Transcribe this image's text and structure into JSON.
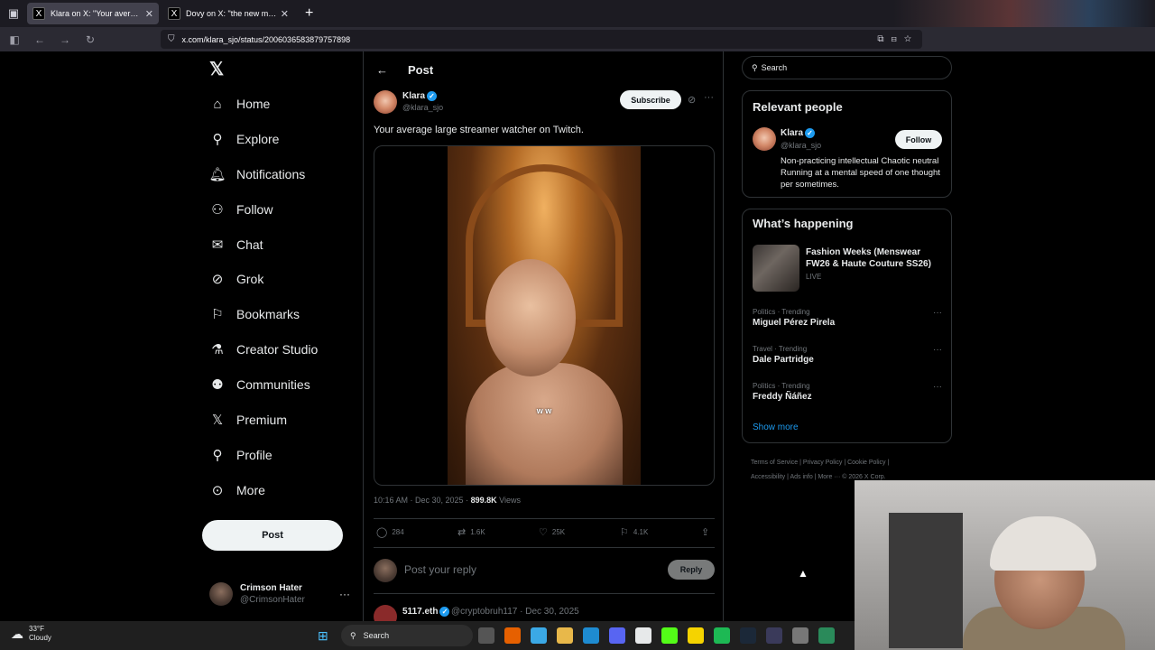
{
  "browser": {
    "tabs": [
      {
        "title": "Klara on X: \"Your average la",
        "active": true
      },
      {
        "title": "Dovy on X: \"the new meta a",
        "active": false
      }
    ],
    "url": "x.com/klara_sjo/status/2006036583879757898"
  },
  "nav": {
    "items": [
      {
        "label": "Home",
        "icon": "home-icon"
      },
      {
        "label": "Explore",
        "icon": "search-icon"
      },
      {
        "label": "Notifications",
        "icon": "bell-icon"
      },
      {
        "label": "Follow",
        "icon": "add-person-icon"
      },
      {
        "label": "Chat",
        "icon": "mail-icon"
      },
      {
        "label": "Grok",
        "icon": "grok-icon"
      },
      {
        "label": "Bookmarks",
        "icon": "bookmark-icon"
      },
      {
        "label": "Creator Studio",
        "icon": "flask-icon"
      },
      {
        "label": "Communities",
        "icon": "people-icon"
      },
      {
        "label": "Premium",
        "icon": "x-logo-icon"
      },
      {
        "label": "Profile",
        "icon": "person-icon"
      },
      {
        "label": "More",
        "icon": "more-circle-icon"
      }
    ],
    "post_button": "Post",
    "account": {
      "name": "Crimson Hater",
      "handle": "@CrimsonHater"
    }
  },
  "post": {
    "header": "Post",
    "author_name": "Klara",
    "author_handle": "@klara_sjo",
    "subscribe": "Subscribe",
    "text": "Your average large streamer watcher on Twitch.",
    "video_caption": "w w",
    "time": "10:16 AM · Dec 30, 2025 · ",
    "views_num": "899.8K",
    "views_label": "Views",
    "replies": "284",
    "reposts": "1.6K",
    "likes": "25K",
    "bookmarks": "4.1K",
    "reply_placeholder": "Post your reply",
    "reply_button": "Reply"
  },
  "next_post": {
    "name": "5117.eth",
    "handle": "@cryptobruh117 · Dec 30, 2025"
  },
  "search": {
    "placeholder": "Search"
  },
  "relevant": {
    "title": "Relevant people",
    "name": "Klara",
    "handle": "@klara_sjo",
    "follow": "Follow",
    "bio": "Non-practicing intellectual Chaotic neutral Running at a mental speed of one thought per sometimes."
  },
  "happening": {
    "title": "What’s happening",
    "featured": "Fashion Weeks (Menswear FW26 & Haute Couture SS26)",
    "featured_status": "LIVE",
    "trends": [
      {
        "category": "Politics · Trending",
        "name": "Miguel Pérez Pirela"
      },
      {
        "category": "Travel · Trending",
        "name": "Dale Partridge"
      },
      {
        "category": "Politics · Trending",
        "name": "Freddy Ñáñez"
      }
    ],
    "show_more": "Show more"
  },
  "footer": {
    "line1": "Terms of Service  |  Privacy Policy  |  Cookie Policy  |",
    "line2": "Accessibility  |  Ads info  |  More ···  © 2026 X Corp."
  },
  "taskbar": {
    "temp": "33°F",
    "condition": "Cloudy",
    "search": "Search"
  }
}
